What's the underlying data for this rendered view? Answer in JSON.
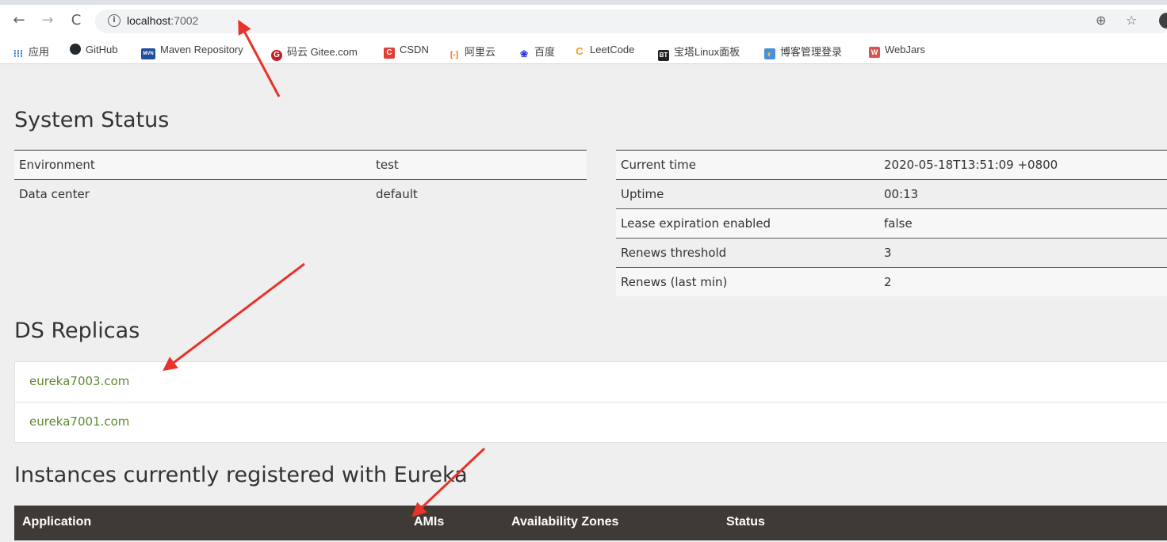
{
  "browser": {
    "url_host": "localhost",
    "url_port": ":7002",
    "info_icon": "ⓘ",
    "bookmarks": [
      {
        "label": "应用",
        "icon": "apps-grid-icon",
        "color": "#1a73e8"
      },
      {
        "label": "GitHub",
        "icon": "github-icon",
        "color": "#24292e"
      },
      {
        "label": "Maven Repository",
        "icon": "mvn-icon",
        "color": "#1f4e9c",
        "badge": "MVN"
      },
      {
        "label": "码云 Gitee.com",
        "icon": "gitee-icon",
        "color": "#c71d23",
        "badge": "G"
      },
      {
        "label": "CSDN",
        "icon": "csdn-icon",
        "color": "#e33e33",
        "badge": "C"
      },
      {
        "label": "阿里云",
        "icon": "aliyun-icon",
        "color": "#ff6a00",
        "badge": "[-]"
      },
      {
        "label": "百度",
        "icon": "baidu-paw-icon",
        "color": "#2932e1",
        "badge": "❀"
      },
      {
        "label": "LeetCode",
        "icon": "leetcode-icon",
        "color": "#f89f1b",
        "badge": "C"
      },
      {
        "label": "宝塔Linux面板",
        "icon": "bt-icon",
        "color": "#222",
        "badge": "BT"
      },
      {
        "label": "博客管理登录",
        "icon": "blog-icon",
        "color": "#e0a800",
        "badge": "◐"
      },
      {
        "label": "WebJars",
        "icon": "webjars-icon",
        "color": "#d9534f",
        "badge": "W"
      }
    ]
  },
  "system_status": {
    "title": "System Status",
    "left": [
      {
        "key": "Environment",
        "value": "test"
      },
      {
        "key": "Data center",
        "value": "default"
      }
    ],
    "right": [
      {
        "key": "Current time",
        "value": "2020-05-18T13:51:09 +0800"
      },
      {
        "key": "Uptime",
        "value": "00:13"
      },
      {
        "key": "Lease expiration enabled",
        "value": "false"
      },
      {
        "key": "Renews threshold",
        "value": "3"
      },
      {
        "key": "Renews (last min)",
        "value": "2"
      }
    ]
  },
  "replicas": {
    "title": "DS Replicas",
    "items": [
      "eureka7003.com",
      "eureka7001.com"
    ]
  },
  "instances": {
    "title": "Instances currently registered with Eureka",
    "columns": [
      "Application",
      "AMIs",
      "Availability Zones",
      "Status"
    ]
  },
  "colors": {
    "link_green": "#5c8a2e",
    "header_dark": "#3f3a35",
    "arrow_red": "#e8322a"
  }
}
